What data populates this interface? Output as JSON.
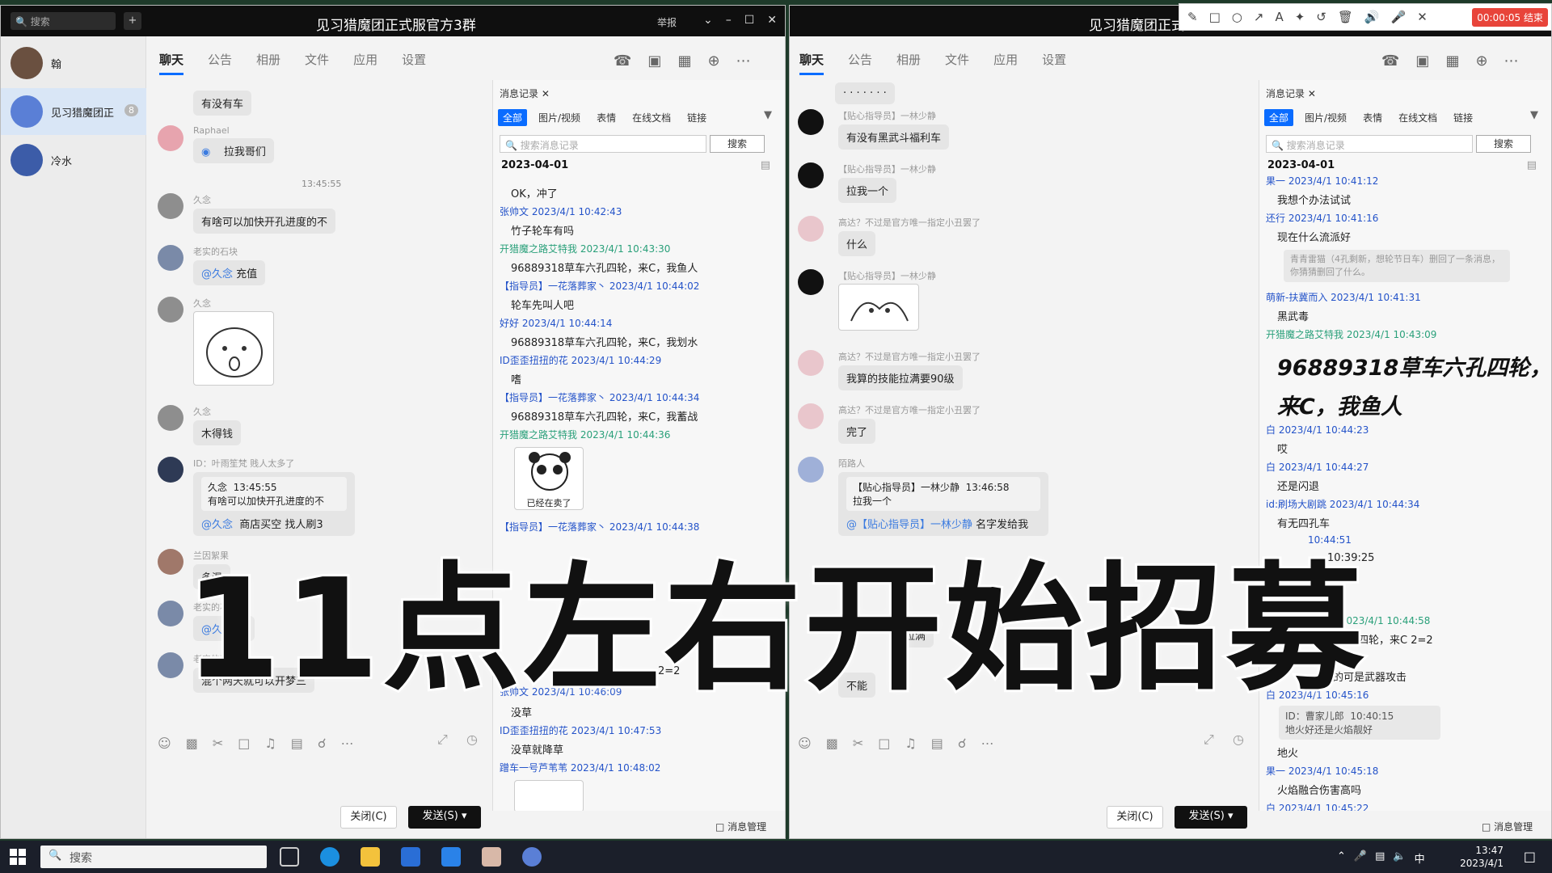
{
  "left_window": {
    "title": "见习猎魔团正式服官方3群",
    "report": "举报",
    "search_placeholder": "搜索",
    "contacts": [
      {
        "name": "翰",
        "badge": ""
      },
      {
        "name": "见习猎魔团正",
        "badge": "8"
      },
      {
        "name": "冷水",
        "badge": ""
      }
    ],
    "tabs": [
      "聊天",
      "公告",
      "相册",
      "文件",
      "应用",
      "设置"
    ],
    "messages": [
      {
        "nick": "",
        "text": "有没有车"
      },
      {
        "nick": "Raphael",
        "text": "拉我哥们"
      },
      {
        "time": "13:45:55"
      },
      {
        "nick": "久念",
        "text": "有啥可以加快开孔进度的不"
      },
      {
        "nick": "老实的石块",
        "mention": "@久念",
        "text": "充值"
      },
      {
        "nick": "久念",
        "text": ""
      },
      {
        "nick": "久念",
        "text": "木得钱"
      },
      {
        "nick": "ID：叶雨笙梵 贱人太多了",
        "quote_name": "久念",
        "quote_time": "13:45:55",
        "quote_text": "有啥可以加快开孔进度的不",
        "mention": "@久念",
        "text": "商店买空 找人刷3"
      },
      {
        "nick": "兰因絮果",
        "text": "多混"
      },
      {
        "nick": "老实的石块",
        "mention": "@久念",
        "text": "当"
      },
      {
        "nick": "老实的石块",
        "text": "混个两天就可以开梦三"
      }
    ],
    "toolbar_close": "关闭(C)",
    "toolbar_send": "发送(S)",
    "history": {
      "title": "消息记录",
      "tabs": [
        "全部",
        "图片/视频",
        "表情",
        "在线文档",
        "链接"
      ],
      "search_placeholder": "搜索消息记录",
      "search_btn": "搜索",
      "date": "2023-04-01",
      "entries": [
        {
          "text": "OK，冲了"
        },
        {
          "name": "张帅文 2023/4/1 10:42:43"
        },
        {
          "text": "竹子轮车有吗"
        },
        {
          "name": "开猎魔之路艾特我 2023/4/1 10:43:30",
          "green": true
        },
        {
          "text": "96889318草车六孔四轮，来C，我鱼人"
        },
        {
          "name": "【指导员】一花落葬家丶 2023/4/1 10:44:02"
        },
        {
          "text": "轮车先叫人吧"
        },
        {
          "name": "好好 2023/4/1 10:44:14"
        },
        {
          "text": "96889318草车六孔四轮，来C，我划水"
        },
        {
          "name": "ID歪歪扭扭的花 2023/4/1 10:44:29"
        },
        {
          "text": "嗜"
        },
        {
          "name": "【指导员】一花落葬家丶 2023/4/1 10:44:34"
        },
        {
          "text": "96889318草车六孔四轮，来C，我蓄战"
        },
        {
          "name": "开猎魔之路艾特我 2023/4/1 10:44:36",
          "green": true
        },
        {
          "sticker": "已经在卖了"
        },
        {
          "name": "【指导员】一花落葬家丶 2023/4/1 10:44:38"
        },
        {
          "text": "2=2"
        },
        {
          "name": "张帅文 2023/4/1 10:46:09"
        },
        {
          "text": "没草"
        },
        {
          "name": "ID歪歪扭扭的花 2023/4/1 10:47:53"
        },
        {
          "text": "没草就降草"
        },
        {
          "name": "蹭车一号芦苇苇 2023/4/1 10:48:02"
        }
      ],
      "manage": "消息管理"
    }
  },
  "right_window": {
    "title": "见习猎魔团正式",
    "tabs": [
      "聊天",
      "公告",
      "相册",
      "文件",
      "应用",
      "设置"
    ],
    "messages": [
      {
        "nick": "【贴心指导员】一林少静",
        "text": "有没有黑武斗福利车"
      },
      {
        "nick": "【贴心指导员】一林少静",
        "text": "拉我一个"
      },
      {
        "nick": "高达？不过是官方唯一指定小丑罢了",
        "text": "什么"
      },
      {
        "nick": "【贴心指导员】一林少静",
        "text": ""
      },
      {
        "nick": "高达？不过是官方唯一指定小丑罢了",
        "text": "我算的技能拉满要90级"
      },
      {
        "nick": "高达？不过是官方唯一指定小丑罢了",
        "text": "完了"
      },
      {
        "nick": "陌路人",
        "quote_name": "【贴心指导员】一林少静",
        "quote_time": "13:46:58",
        "quote_text": "拉我一个",
        "mention": "@【贴心指导员】一林少静",
        "text": "名字发给我"
      },
      {
        "nick": "",
        "text": "拉满"
      },
      {
        "nick": "",
        "text": "不能"
      }
    ],
    "toolbar_close": "关闭(C)",
    "toolbar_send": "发送(S)",
    "history": {
      "title": "消息记录",
      "tabs": [
        "全部",
        "图片/视频",
        "表情",
        "在线文档",
        "链接"
      ],
      "search_placeholder": "搜索消息记录",
      "search_btn": "搜索",
      "date": "2023-04-01",
      "entries": [
        {
          "name": "果一 2023/4/1 10:41:12"
        },
        {
          "text": "我想个办法试试"
        },
        {
          "name": "还行 2023/4/1 10:41:16"
        },
        {
          "text": "现在什么流派好"
        },
        {
          "quote": "青青雷猫（4孔剩新，想轮节日车）删回了一条消息，你猜猜删回了什么。"
        },
        {
          "name": "萌新-扶冀而入 2023/4/1 10:41:31"
        },
        {
          "text": "黑武毒"
        },
        {
          "name": "开猎魔之路艾特我 2023/4/1 10:43:09",
          "green": true
        },
        {
          "big1": "96889318草车六孔四轮，",
          "big2": "来C，我鱼人"
        },
        {
          "name": "白 2023/4/1 10:44:23"
        },
        {
          "text": "哎"
        },
        {
          "name": "白 2023/4/1 10:44:27"
        },
        {
          "text": "还是闪退"
        },
        {
          "name": "id:刷场大剧跳 2023/4/1 10:44:34"
        },
        {
          "text": "有无四孔车"
        },
        {
          "name": "10:44:51"
        },
        {
          "text": "10:39:25"
        },
        {
          "name": "我 2023/4/1 10:44:58"
        },
        {
          "text": "草车六孔四轮，来C 2=2"
        },
        {
          "name": "1 10:45:02"
        },
        {
          "text": "说的可是武器攻击"
        },
        {
          "name": "白 2023/4/1 10:45:16"
        },
        {
          "quote2_name": "ID：曹家儿郎",
          "quote2_time": "10:40:15",
          "quote2_text": "地火好还是火焰靓好"
        },
        {
          "text": "地火"
        },
        {
          "name": "果一 2023/4/1 10:45:18"
        },
        {
          "text": "火焰融合伤害高吗"
        },
        {
          "name": "白 2023/4/1 10:45:22"
        }
      ],
      "manage": "消息管理"
    }
  },
  "recorder": {
    "time": "00:00:05 结束"
  },
  "overlay_text": "11点左右开始招募",
  "taskbar": {
    "search": "搜索",
    "time": "13:47",
    "date": "2023/4/1",
    "ime": "中"
  }
}
